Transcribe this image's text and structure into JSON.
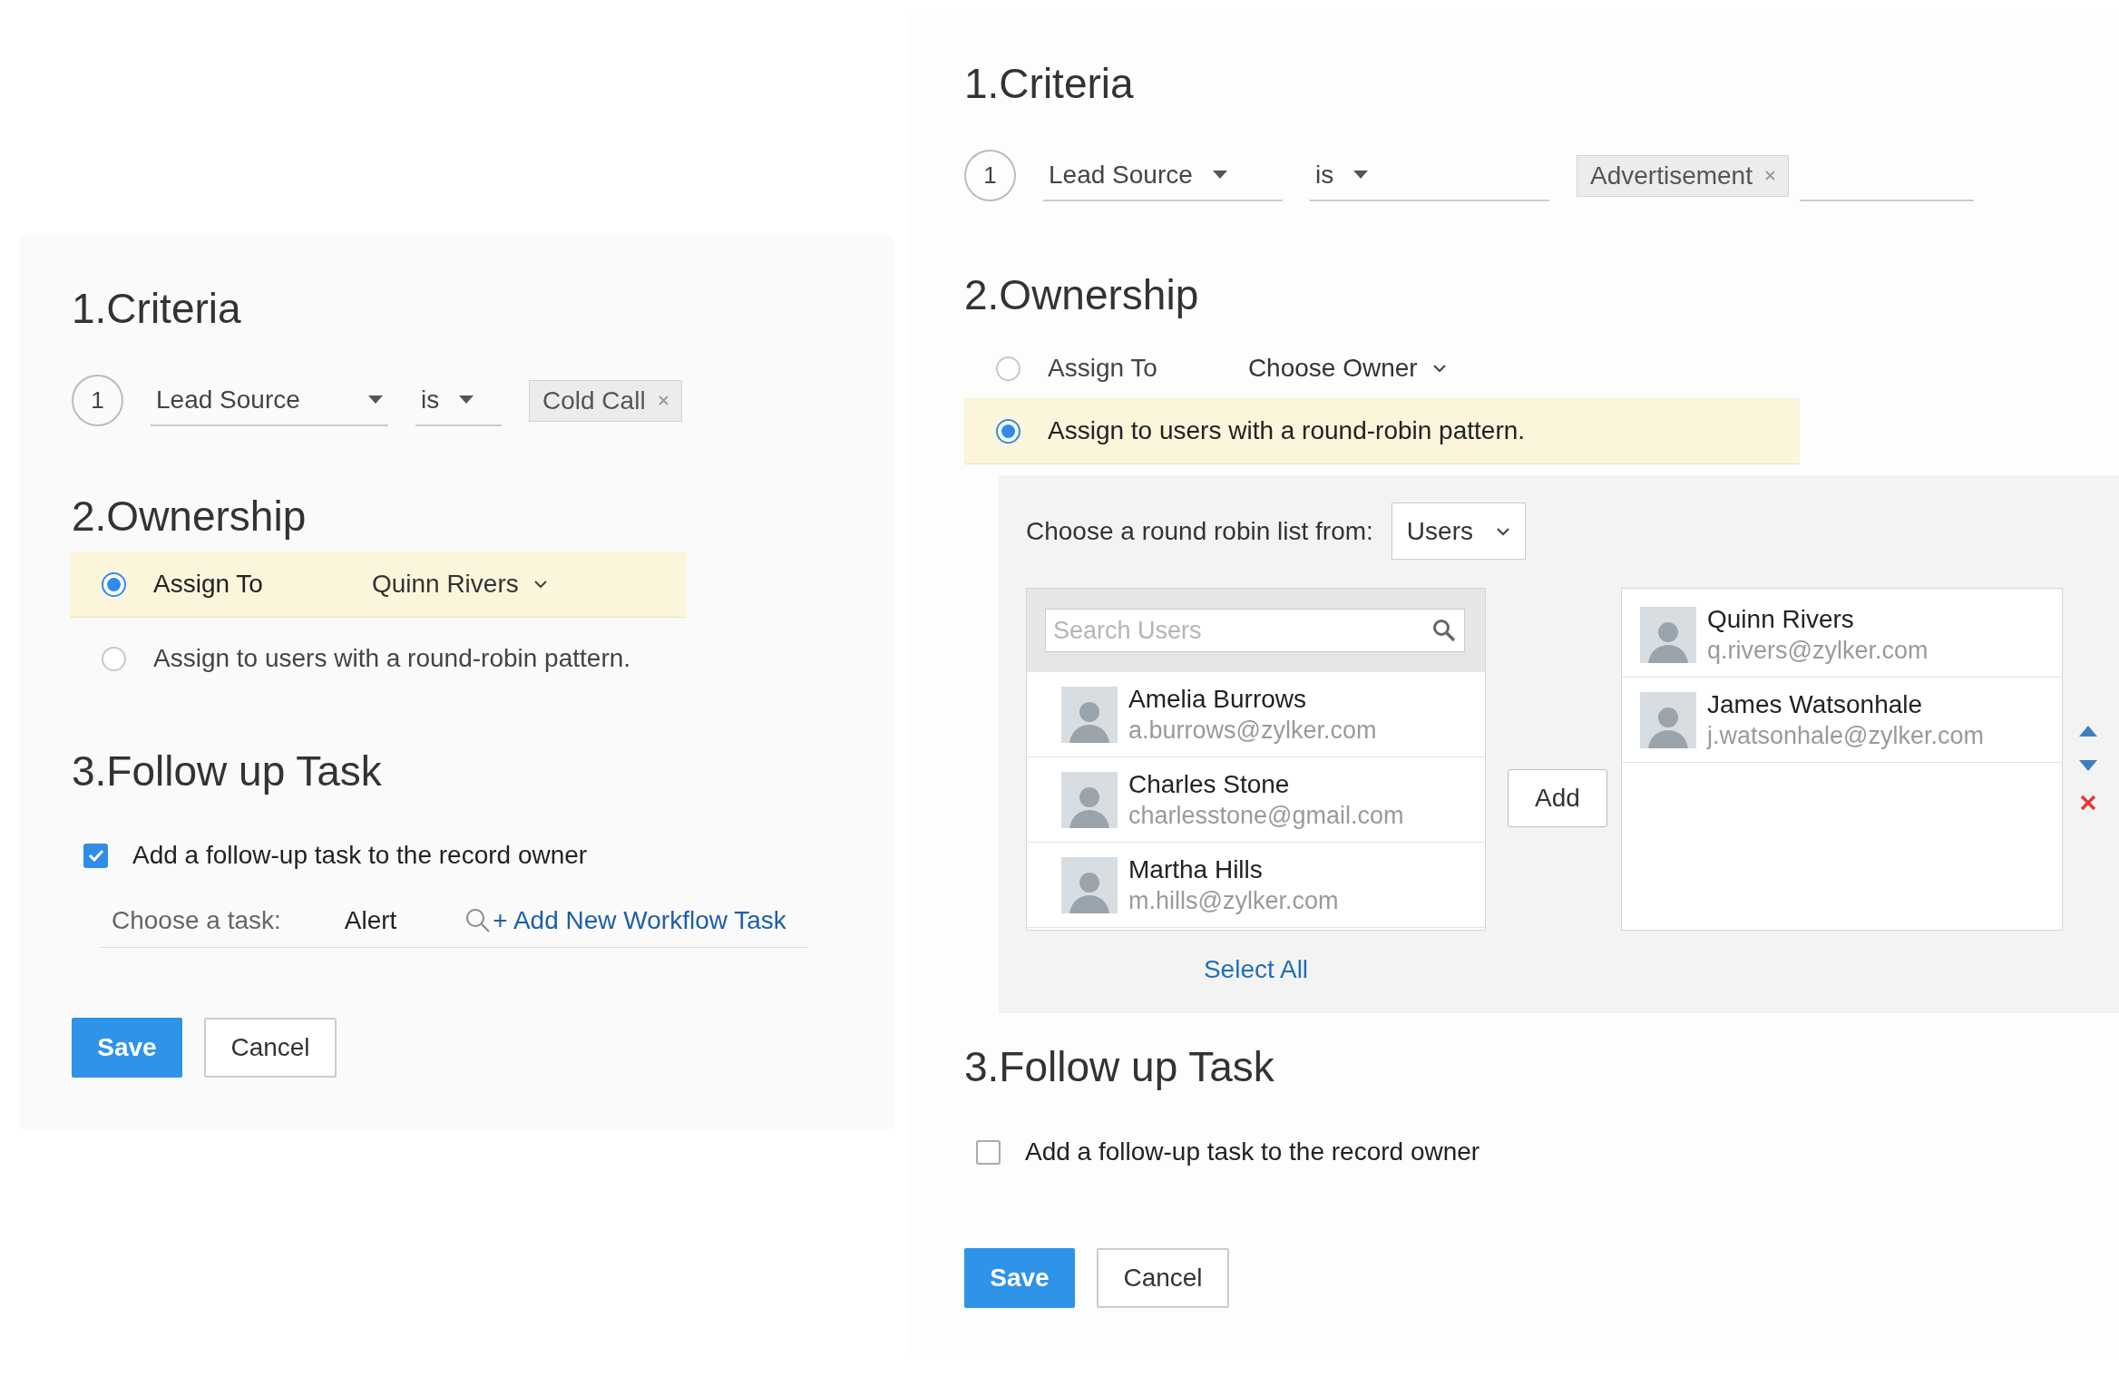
{
  "panels": [
    {
      "criteria": {
        "title": "1.Criteria",
        "rows": [
          {
            "index": "1",
            "field": "Lead Source",
            "operator": "is",
            "values": [
              "Cold Call"
            ]
          }
        ]
      },
      "ownership": {
        "title": "2.Ownership",
        "options": [
          {
            "label": "Assign To",
            "selected": true,
            "owner": "Quinn Rivers"
          },
          {
            "label": "Assign to users with a round-robin pattern.",
            "selected": false
          }
        ]
      },
      "follow_up": {
        "title": "3.Follow up Task",
        "checkbox": {
          "label": "Add a follow-up task to the record owner",
          "checked": true
        },
        "task": {
          "label": "Choose a task:",
          "value": "Alert",
          "link": "+ Add New Workflow Task"
        }
      },
      "buttons": [
        "Save",
        "Cancel"
      ]
    },
    {
      "criteria": {
        "title": "1.Criteria",
        "rows": [
          {
            "index": "1",
            "field": "Lead Source",
            "operator": "is",
            "values": [
              "Advertisement"
            ],
            "extra_input": true
          }
        ]
      },
      "ownership": {
        "title": "2.Ownership",
        "options": [
          {
            "label": "Assign To",
            "selected": false,
            "owner": "Choose Owner"
          },
          {
            "label": "Assign to users with a round-robin pattern.",
            "selected": true,
            "round_robin": {
              "label": "Choose a round robin list from:",
              "list_type": "Users",
              "search_placeholder": "Search Users",
              "available": [
                {
                  "name": "Amelia Burrows",
                  "email": "a.burrows@zylker.com"
                },
                {
                  "name": "Charles Stone",
                  "email": "charlesstone@gmail.com"
                },
                {
                  "name": "Martha Hills",
                  "email": "m.hills@zylker.com"
                }
              ],
              "add_button": "Add",
              "chosen": [
                {
                  "name": "Quinn Rivers",
                  "email": "q.rivers@zylker.com"
                },
                {
                  "name": "James Watsonhale",
                  "email": "j.watsonhale@zylker.com"
                }
              ],
              "select_all": "Select All"
            }
          }
        ]
      },
      "follow_up": {
        "title": "3.Follow up Task",
        "checkbox": {
          "label": "Add a follow-up task to the record owner",
          "checked": false
        }
      },
      "buttons": [
        "Save",
        "Cancel"
      ]
    }
  ]
}
